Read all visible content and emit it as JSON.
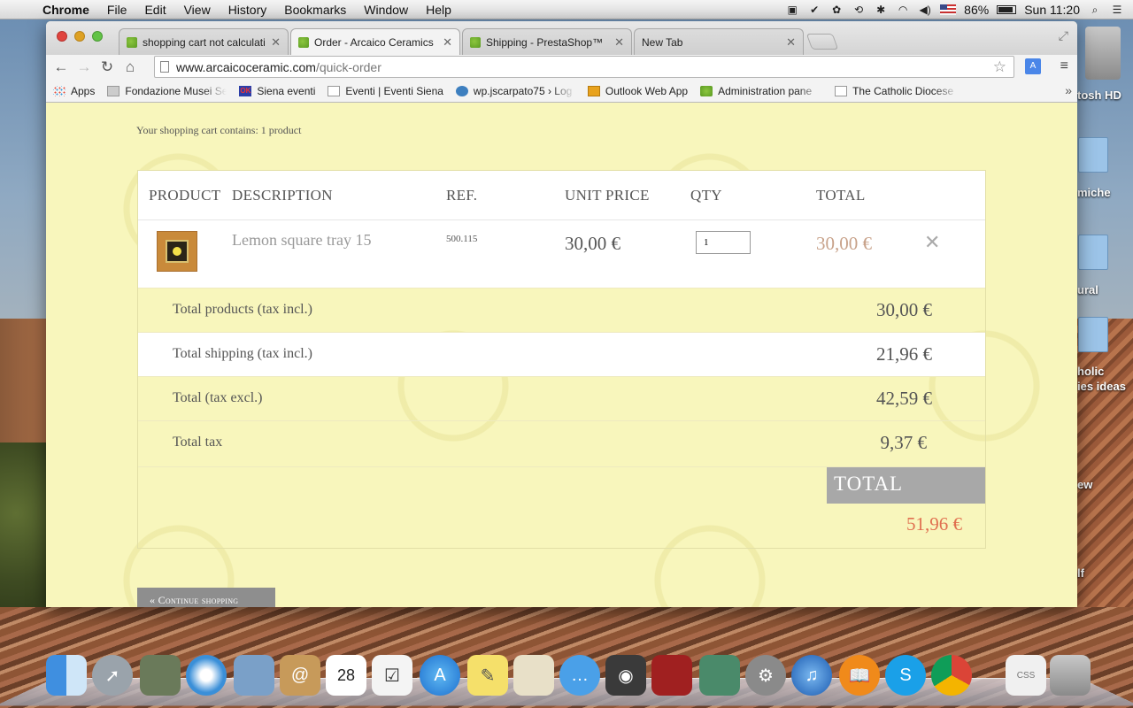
{
  "menubar": {
    "app_name": "Chrome",
    "items": [
      "File",
      "Edit",
      "View",
      "History",
      "Bookmarks",
      "Window",
      "Help"
    ],
    "battery": "86%",
    "clock": "Sun 11:20"
  },
  "browser": {
    "tabs": [
      {
        "label": "shopping cart not calculati"
      },
      {
        "label": "Order - Arcaico Ceramics"
      },
      {
        "label": "Shipping - PrestaShop™"
      },
      {
        "label": "New Tab"
      }
    ],
    "url_host": "www.arcaicoceramic.com",
    "url_path": "/quick-order",
    "bookmarks": [
      "Apps",
      "Fondazione Musei Se",
      "Siena eventi",
      "Eventi | Eventi Siena",
      "wp.jscarpato75 › Log",
      "Outlook Web App",
      "Administration pane",
      "The Catholic Diocese"
    ]
  },
  "cart": {
    "summary": "Your shopping cart contains: 1 product",
    "headers": {
      "product": "PRODUCT",
      "description": "DESCRIPTION",
      "ref": "REF.",
      "unit_price": "UNIT PRICE",
      "qty": "QTY",
      "total": "TOTAL"
    },
    "item": {
      "name": "Lemon square tray 15",
      "ref": "500.115",
      "unit_price": "30,00 €",
      "qty": "1",
      "total": "30,00 €"
    },
    "totals": {
      "products_label": "Total products (tax incl.)",
      "products_value": "30,00 €",
      "shipping_label": "Total shipping (tax incl.)",
      "shipping_value": "21,96 €",
      "tax_excl_label": "Total (tax excl.)",
      "tax_excl_value": "42,59 €",
      "tax_label": "Total tax",
      "tax_value": "9,37 €",
      "grand_label": "TOTAL",
      "grand_value": "51,96 €"
    },
    "continue_label": "« Continue shopping"
  },
  "desktop": {
    "labels": [
      "tosh HD",
      "miche",
      "ural",
      "holic",
      "ies ideas",
      "ew",
      "lf"
    ]
  },
  "colors": {
    "page_bg": "#f8f6bc",
    "grand_total": "#e07050",
    "item_total": "#c8a28a",
    "grand_label_bg": "#a8a8a8"
  }
}
